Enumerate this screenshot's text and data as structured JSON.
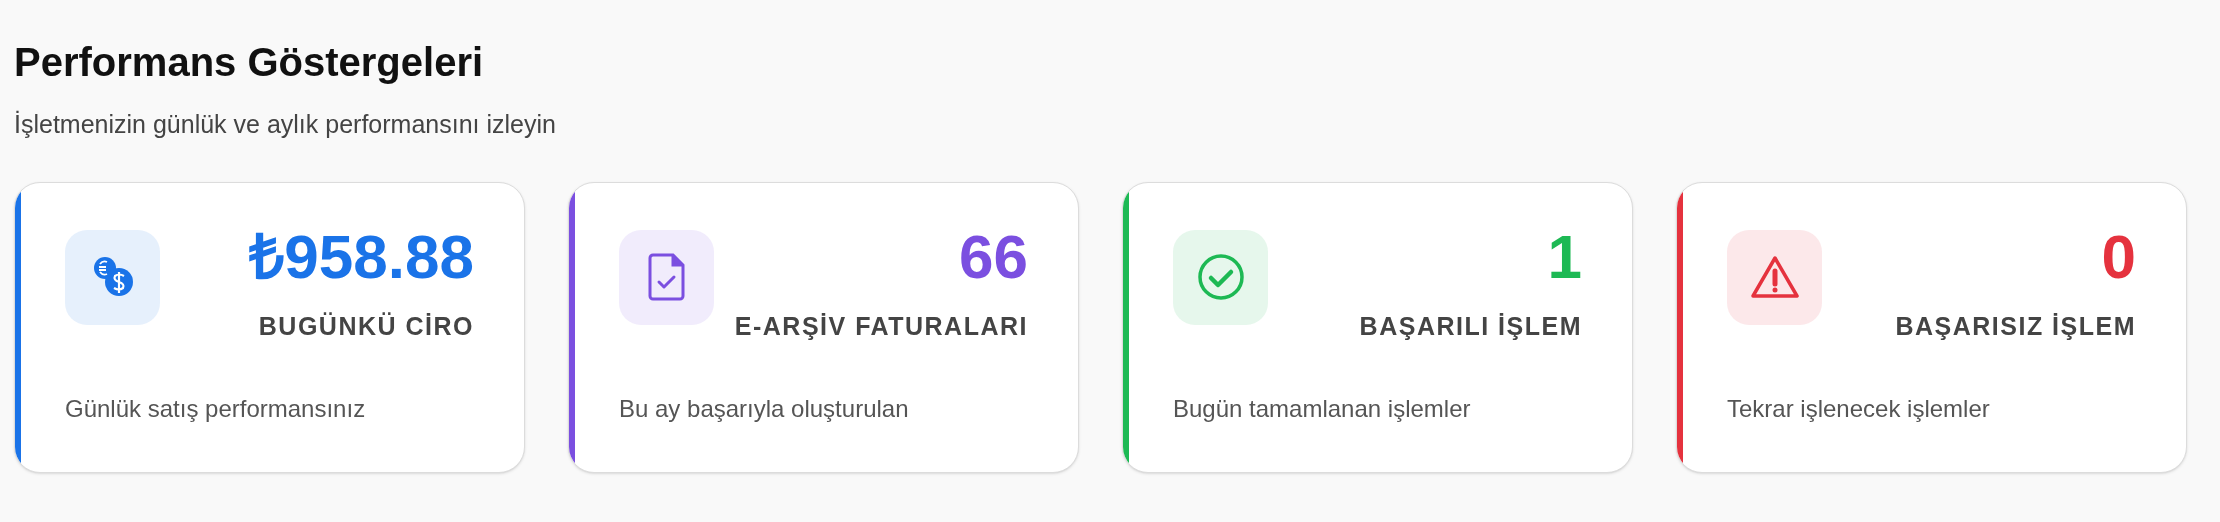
{
  "header": {
    "title": "Performans Göstergeleri",
    "subtitle": "İşletmenizin günlük ve aylık performansını izleyin"
  },
  "cards": [
    {
      "kind": "coins",
      "color": "#1a73e8",
      "value": "₺958.88",
      "label": "BUGÜNKÜ CİRO",
      "description": "Günlük satış performansınız"
    },
    {
      "kind": "document-check",
      "color": "#7b4fe0",
      "value": "66",
      "label": "E-ARŞİV FATURALARI",
      "description": "Bu ay başarıyla oluşturulan"
    },
    {
      "kind": "check-circle",
      "color": "#1db954",
      "value": "1",
      "label": "BAŞARILI İŞLEM",
      "description": "Bugün tamamlanan işlemler"
    },
    {
      "kind": "warning",
      "color": "#e5323e",
      "value": "0",
      "label": "BAŞARISIZ İŞLEM",
      "description": "Tekrar işlenecek işlemler"
    }
  ]
}
